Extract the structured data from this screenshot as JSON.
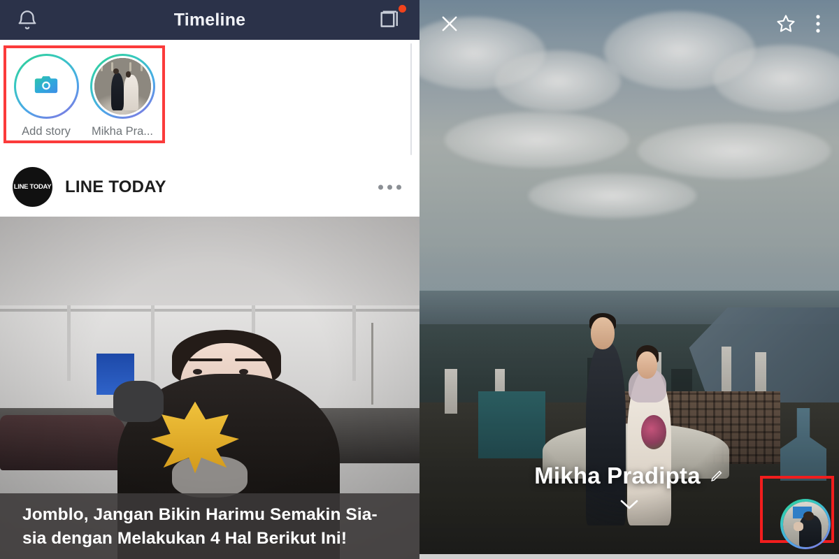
{
  "left_panel": {
    "topbar": {
      "title": "Timeline",
      "notifications_icon": "bell-icon",
      "compose_icon": "compose-square-icon",
      "has_unread_dot": true,
      "background_color": "#2b3249"
    },
    "story_tray": {
      "highlight_color": "#fb3b3b",
      "items": [
        {
          "label": "Add story",
          "icon": "camera-icon",
          "type": "add"
        },
        {
          "label": "Mikha Pra...",
          "icon": "user-photo",
          "type": "story"
        }
      ]
    },
    "post": {
      "author": "LINE TODAY",
      "avatar_text": "LINE TODAY",
      "more_icon": "more-horizontal-icon",
      "caption": "Jomblo, Jangan Bikin Harimu Semakin Sia-sia dengan Melakukan 4 Hal Berikut Ini!"
    }
  },
  "right_panel": {
    "topbar": {
      "close_icon": "close-x-icon",
      "favorite_icon": "star-outline-icon",
      "menu_icon": "more-vertical-icon"
    },
    "profile": {
      "name": "Mikha Pradipta",
      "edit_icon": "pencil-edit-icon",
      "expand_icon": "chevron-down-icon"
    },
    "avatar_highlight": {
      "highlight_color": "#f21d1d",
      "icon": "profile-avatar"
    }
  },
  "colors": {
    "header_navy": "#2b3249",
    "highlight_red": "#fb3b3b",
    "notification_dot": "#f0431c",
    "ring_gradient_start": "#2ecf8e",
    "ring_gradient_end": "#8b6ee0"
  }
}
